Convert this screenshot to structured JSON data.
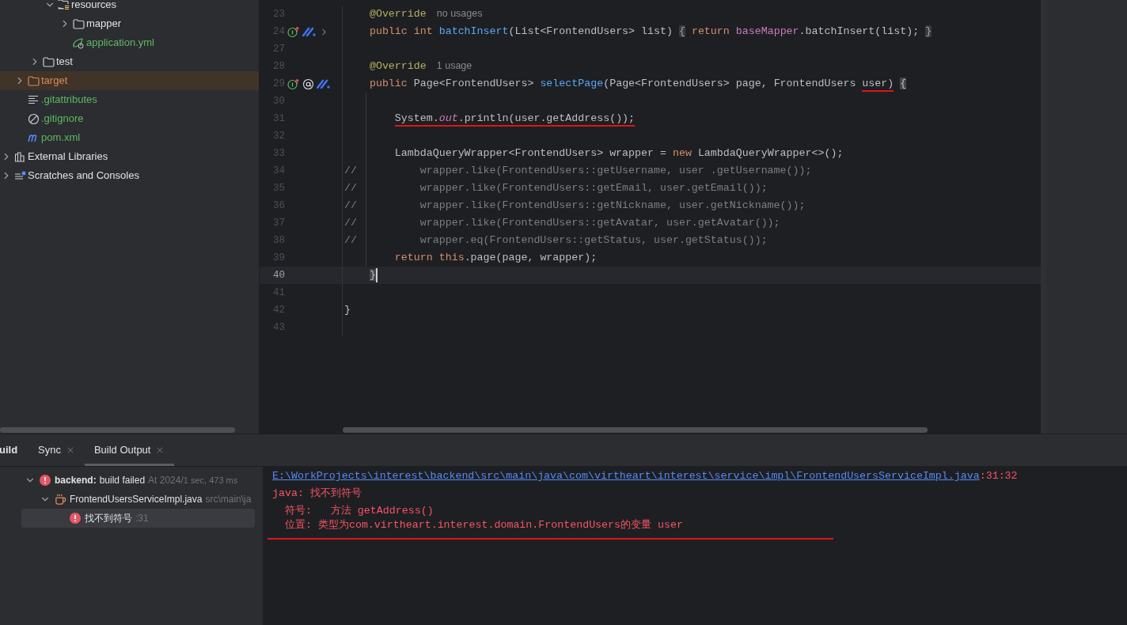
{
  "project_tree": [
    {
      "children": [
        {
          "children": [
            {
              "children": [
                {
                  "label": "resources",
                  "kind": "resources",
                  "expanded": true,
                  "selected": false,
                  "children": [
                    {
                      "label": "mapper",
                      "kind": "folder",
                      "expanded": false,
                      "selected": false
                    },
                    {
                      "label": "application.yml",
                      "kind": "yml",
                      "color": "#5fb865",
                      "selected": false
                    }
                  ]
                }
              ]
            },
            {
              "label": "test",
              "kind": "folder",
              "expanded": false,
              "selected": false
            }
          ]
        },
        {
          "label": "target",
          "kind": "excluded",
          "color": "#e08855",
          "expanded": false,
          "selected": true
        },
        {
          "label": ".gitattributes",
          "kind": "text",
          "color": "#5fb865",
          "selected": false
        },
        {
          "label": ".gitignore",
          "kind": "ignore",
          "color": "#5fb865",
          "selected": false
        },
        {
          "label": "pom.xml",
          "kind": "maven",
          "color": "#5fb865",
          "selected": false
        }
      ]
    },
    {
      "label": "External Libraries",
      "kind": "libraries",
      "expanded": false,
      "selected": false
    },
    {
      "label": "Scratches and Consoles",
      "kind": "scratches",
      "expanded": false,
      "selected": false
    }
  ],
  "editor": {
    "lines": [
      {
        "number": "23",
        "tokens": [
          {
            "text": "    @Override",
            "kind": "annotation"
          },
          {
            "text": "no usages",
            "kind": "hint"
          }
        ]
      },
      {
        "number": "24",
        "gutter": [
          {
            "kind": "implements"
          },
          {
            "kind": "mybatis"
          },
          {
            "kind": "fold"
          }
        ],
        "tokens": [
          {
            "text": "    public int ",
            "kind": "keyword"
          },
          {
            "text": "batchInsert",
            "kind": "method"
          },
          {
            "text": "(List<FrontendUsers> list) ",
            "kind": "plain"
          },
          {
            "text": "{",
            "kind": "fold"
          },
          {
            "text": " return ",
            "kind": "keyword"
          },
          {
            "text": "baseMapper",
            "kind": "field"
          },
          {
            "text": ".batchInsert(list); ",
            "kind": "plain"
          },
          {
            "text": "}",
            "kind": "fold"
          }
        ]
      },
      {
        "number": "27"
      },
      {
        "number": "28",
        "tokens": [
          {
            "text": "    @Override",
            "kind": "annotation"
          },
          {
            "text": "1 usage",
            "kind": "hint"
          }
        ]
      },
      {
        "number": "29",
        "gutter": [
          {
            "kind": "implements"
          },
          {
            "kind": "at"
          },
          {
            "kind": "mybatis"
          }
        ],
        "tokens": [
          {
            "text": "    public ",
            "kind": "keyword"
          },
          {
            "text": "Page<FrontendUsers> ",
            "kind": "plain"
          },
          {
            "text": "selectPage",
            "kind": "method"
          },
          {
            "text": "(Page<FrontendUsers> page, FrontendUsers ",
            "kind": "plain"
          },
          {
            "text": "user)",
            "kind": "plain",
            "underline": true
          },
          {
            "text": " {",
            "kind": "brace"
          }
        ]
      },
      {
        "number": "30"
      },
      {
        "number": "31",
        "tokens": [
          {
            "text": "        System.",
            "kind": "plain",
            "underline": true
          },
          {
            "text": "out",
            "kind": "static",
            "underline": true
          },
          {
            "text": ".println(user.getAddress());",
            "kind": "plain",
            "underline": true
          }
        ]
      },
      {
        "number": "32"
      },
      {
        "number": "33",
        "tokens": [
          {
            "text": "        LambdaQueryWrapper<FrontendUsers> wrapper = ",
            "kind": "plain"
          },
          {
            "text": "new",
            "kind": "keyword"
          },
          {
            "text": " LambdaQueryWrapper<>();",
            "kind": "plain"
          }
        ]
      },
      {
        "number": "34",
        "tokens": [
          {
            "text": "//          wrapper.like(FrontendUsers::getUsername, user .getUsername());",
            "kind": "comment"
          }
        ]
      },
      {
        "number": "35",
        "tokens": [
          {
            "text": "//          wrapper.like(FrontendUsers::getEmail, user.getEmail());",
            "kind": "comment"
          }
        ]
      },
      {
        "number": "36",
        "tokens": [
          {
            "text": "//          wrapper.like(FrontendUsers::getNickname, user.getNickname());",
            "kind": "comment"
          }
        ]
      },
      {
        "number": "37",
        "tokens": [
          {
            "text": "//          wrapper.like(FrontendUsers::getAvatar, user.getAvatar());",
            "kind": "comment"
          }
        ]
      },
      {
        "number": "38",
        "tokens": [
          {
            "text": "//          wrapper.eq(FrontendUsers::getStatus, user.getStatus());",
            "kind": "comment"
          }
        ]
      },
      {
        "number": "39",
        "tokens": [
          {
            "text": "        return this",
            "kind": "keyword"
          },
          {
            "text": ".page(page, wrapper);",
            "kind": "plain"
          }
        ]
      },
      {
        "number": "40",
        "current": true,
        "tokens": [
          {
            "text": "    }",
            "kind": "brace"
          }
        ]
      },
      {
        "number": "41"
      },
      {
        "number": "42",
        "tokens": [
          {
            "text": "}",
            "kind": "plain"
          }
        ]
      },
      {
        "number": "43"
      }
    ]
  },
  "build_panel": {
    "title": "uild",
    "tabs": [
      {
        "label": "Sync",
        "selected": false
      },
      {
        "label": "Build Output",
        "selected": true
      }
    ],
    "tree": [
      {
        "kind": "error",
        "bold": "backend:",
        "label": "build failed",
        "detail": "At 2024/",
        "detail2": "1 sec, 473 ms",
        "expanded": true,
        "selected": false,
        "children": [
          {
            "kind": "java",
            "label": "FrontendUsersServiceImpl.java",
            "detail": "src\\main\\ja",
            "expanded": true,
            "selected": false,
            "children": [
              {
                "kind": "error",
                "label": "找不到符号",
                "detail": ":31",
                "selected": true
              }
            ]
          }
        ]
      }
    ],
    "console": [
      {
        "kind": "link",
        "text": "E:\\WorkProjects\\interest\\backend\\src\\main\\java\\com\\virtheart\\interest\\service\\impl\\FrontendUsersServiceImpl.java",
        "suffix": ":31:32"
      },
      {
        "kind": "error",
        "text": "java: 找不到符号"
      },
      {
        "kind": "error",
        "text": "  符号:   方法 getAddress()"
      },
      {
        "kind": "error",
        "text": "  位置: 类型为com.virtheart.interest.domain.FrontendUsers的变量 user",
        "underline": true
      }
    ]
  }
}
